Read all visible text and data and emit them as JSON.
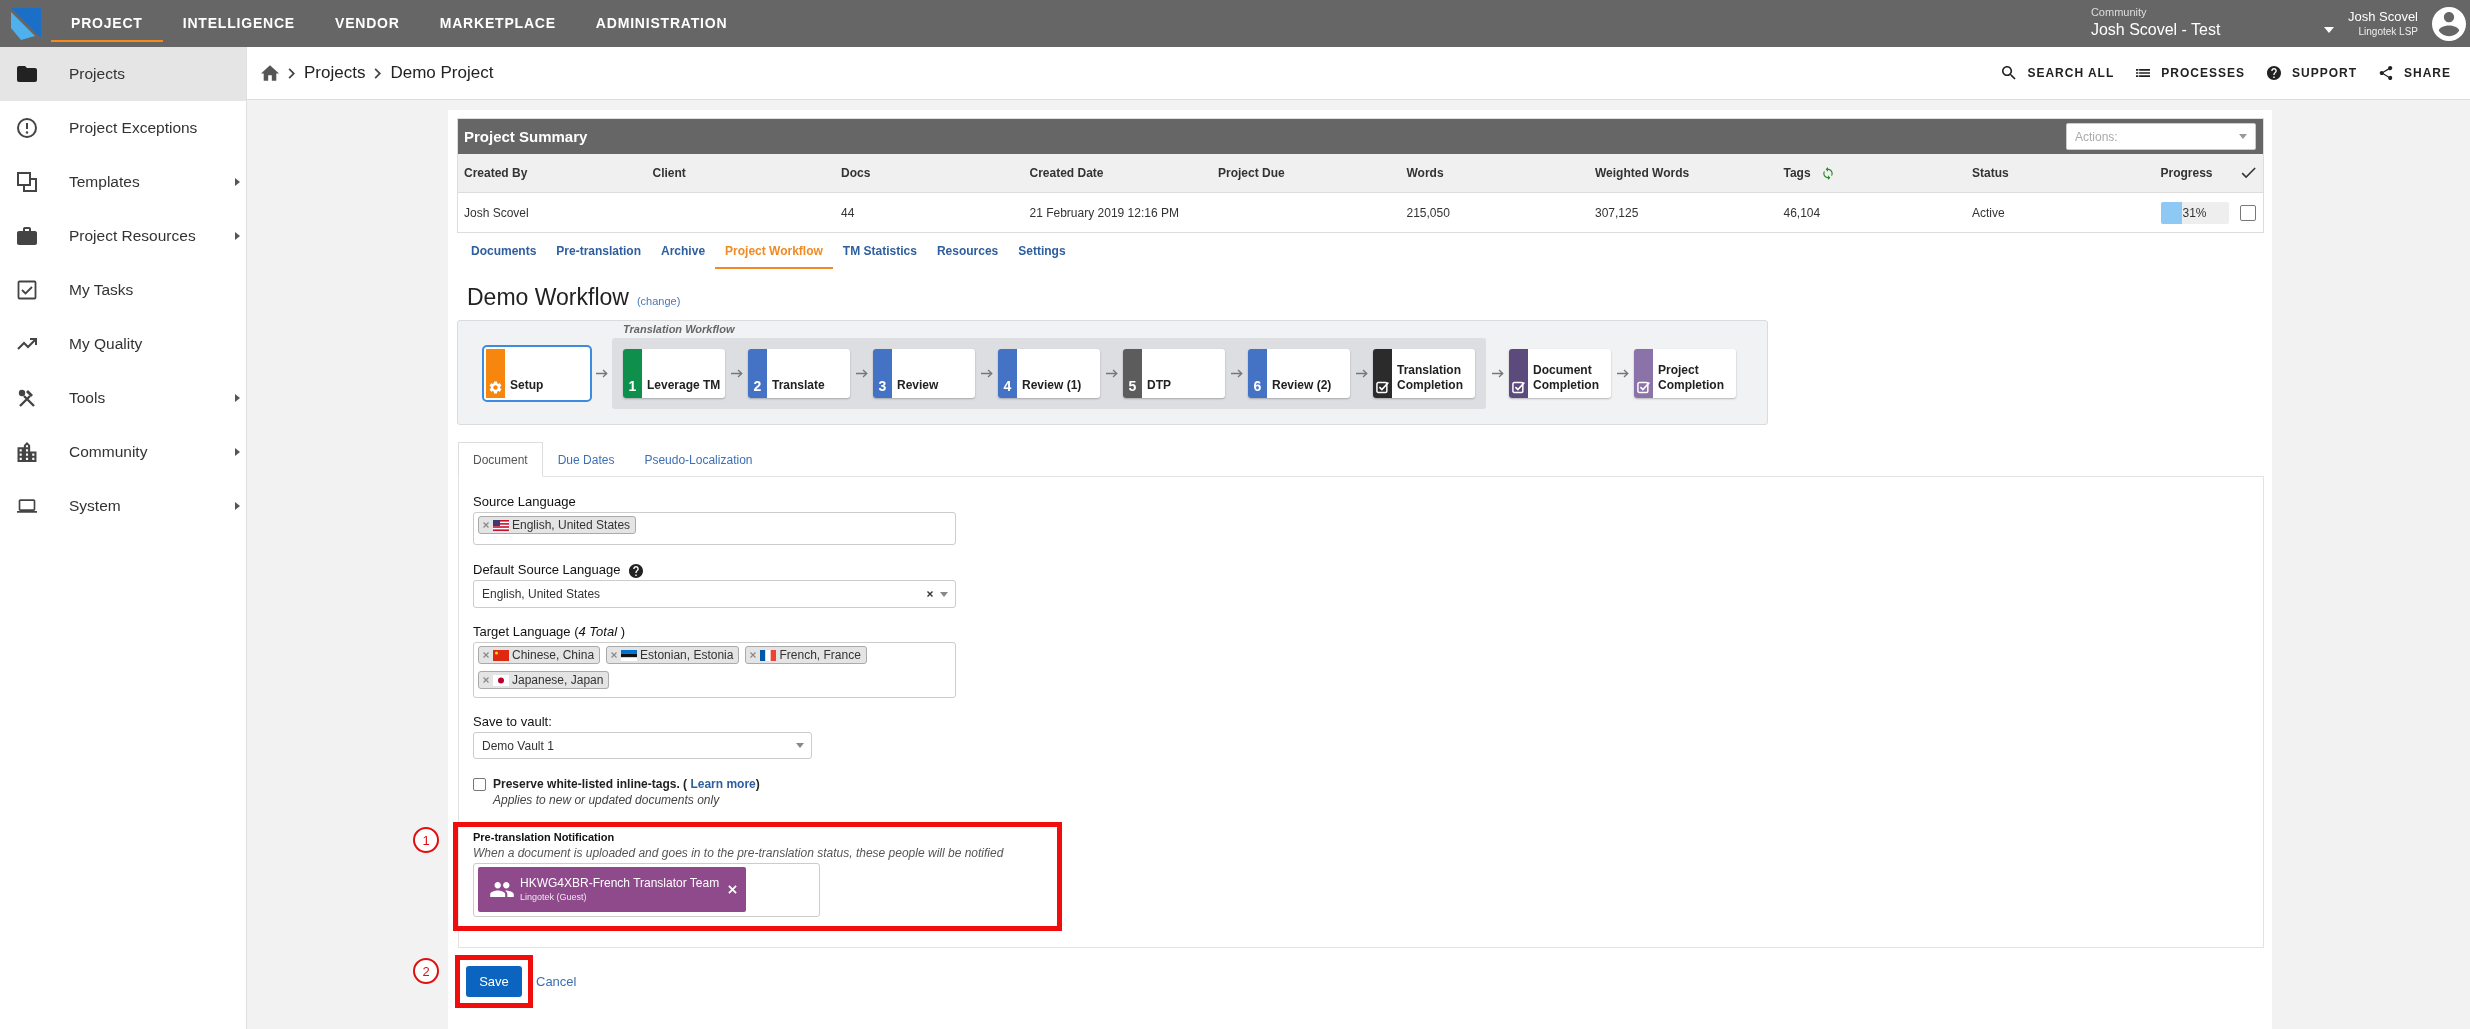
{
  "top_nav": {
    "tabs": [
      {
        "label": "PROJECT",
        "selected": true
      },
      {
        "label": "INTELLIGENCE",
        "selected": false
      },
      {
        "label": "VENDOR",
        "selected": false
      },
      {
        "label": "MARKETPLACE",
        "selected": false
      },
      {
        "label": "ADMINISTRATION",
        "selected": false
      }
    ],
    "community": {
      "label": "Community",
      "value": "Josh Scovel - Test"
    },
    "user": {
      "name": "Josh Scovel",
      "organization": "Lingotek LSP"
    }
  },
  "sidebar": {
    "items": [
      {
        "label": "Projects",
        "selected": true,
        "submenu": false
      },
      {
        "label": "Project Exceptions",
        "selected": false,
        "submenu": false
      },
      {
        "label": "Templates",
        "selected": false,
        "submenu": true
      },
      {
        "label": "Project Resources",
        "selected": false,
        "submenu": true
      },
      {
        "label": "My Tasks",
        "selected": false,
        "submenu": false
      },
      {
        "label": "My Quality",
        "selected": false,
        "submenu": false
      },
      {
        "label": "Tools",
        "selected": false,
        "submenu": true
      },
      {
        "label": "Community",
        "selected": false,
        "submenu": true
      },
      {
        "label": "System",
        "selected": false,
        "submenu": true
      }
    ]
  },
  "breadcrumb": [
    {
      "label": "Projects"
    },
    {
      "label": "Demo Project"
    }
  ],
  "toolbar": [
    {
      "label": "SEARCH ALL"
    },
    {
      "label": "PROCESSES"
    },
    {
      "label": "SUPPORT"
    },
    {
      "label": "SHARE"
    }
  ],
  "project_summary": {
    "title": "Project Summary",
    "actions": {
      "placeholder": "Actions:"
    },
    "columns": [
      "Created By",
      "Client",
      "Docs",
      "Created Date",
      "Project Due",
      "Words",
      "Weighted Words",
      "Tags",
      "Status",
      "Progress"
    ],
    "rows": [
      {
        "created_by": "Josh Scovel",
        "docs": "44",
        "created_date": "21 February 2019 12:16 PM",
        "words": "215,050",
        "weighted_words": "307,125",
        "tags": "46,104",
        "status": "Active",
        "progress": {
          "level": 0.31,
          "reading": "31%"
        },
        "checked": false
      }
    ]
  },
  "project_tabs": [
    {
      "label": "Documents",
      "selected": false
    },
    {
      "label": "Pre-translation",
      "selected": false
    },
    {
      "label": "Archive",
      "selected": false
    },
    {
      "label": "Project Workflow",
      "selected": true
    },
    {
      "label": "TM Statistics",
      "selected": false
    },
    {
      "label": "Resources",
      "selected": false
    },
    {
      "label": "Settings",
      "selected": false
    }
  ],
  "workflow": {
    "title": "Demo Workflow",
    "change_link": "(change)",
    "before": [
      {
        "kind": "setup",
        "label": "Setup",
        "color": "#f7860f",
        "selected": true
      }
    ],
    "group": {
      "label": "Translation Workflow",
      "nodes": [
        {
          "kind": "step",
          "number": "1",
          "label": "Leverage TM",
          "color": "#0f8f4c",
          "selected": false
        },
        {
          "kind": "step",
          "number": "2",
          "label": "Translate",
          "color": "#4472c4",
          "selected": false
        },
        {
          "kind": "step",
          "number": "3",
          "label": "Review",
          "color": "#4472c4",
          "selected": false
        },
        {
          "kind": "step",
          "number": "4",
          "label": "Review (1)",
          "color": "#4472c4",
          "selected": false
        },
        {
          "kind": "step",
          "number": "5",
          "label": "DTP",
          "color": "#5c5c5c",
          "selected": false
        },
        {
          "kind": "step",
          "number": "6",
          "label": "Review (2)",
          "color": "#4472c4",
          "selected": false
        },
        {
          "kind": "completion",
          "label": "Translation Completion",
          "color": "#2b2b2b",
          "selected": false
        }
      ]
    },
    "after": [
      {
        "kind": "completion",
        "label": "Document Completion",
        "color": "#5d4a7c",
        "selected": false
      },
      {
        "kind": "completion",
        "label": "Project Completion",
        "color": "#8b72a8",
        "selected": false
      }
    ]
  },
  "settings_tabs": [
    {
      "label": "Document",
      "selected": true
    },
    {
      "label": "Due Dates",
      "selected": false
    },
    {
      "label": "Pseudo-Localization",
      "selected": false
    }
  ],
  "form": {
    "source_language": {
      "label": "Source Language",
      "tags": [
        {
          "label": "English, United States"
        }
      ]
    },
    "default_source_language": {
      "label": "Default Source Language",
      "value": "English, United States"
    },
    "target_language": {
      "label": "Target Language (*4 Total* )",
      "tags": [
        {
          "label": "Chinese, China"
        },
        {
          "label": "Estonian, Estonia"
        },
        {
          "label": "French, France"
        },
        {
          "label": "Japanese, Japan"
        }
      ]
    },
    "vault": {
      "label": "Save to vault:",
      "value": "Demo Vault 1"
    },
    "preserve_tags": {
      "checked": false,
      "label": "Preserve white-listed inline-tags. ( ",
      "link": "Learn more",
      "label_end": ")",
      "note": "Applies to new or updated documents only"
    },
    "notification": {
      "callout": "1",
      "label": "Pre-translation Notification",
      "description": "When a document is uploaded and goes in to the pre-translation status, these people will be notified",
      "recipients": [
        {
          "name": "HKWG4XBR-French Translator Team",
          "detail": "Lingotek (Guest)"
        }
      ]
    }
  },
  "actions": {
    "callout": "2",
    "save": "Save",
    "cancel": "Cancel"
  }
}
